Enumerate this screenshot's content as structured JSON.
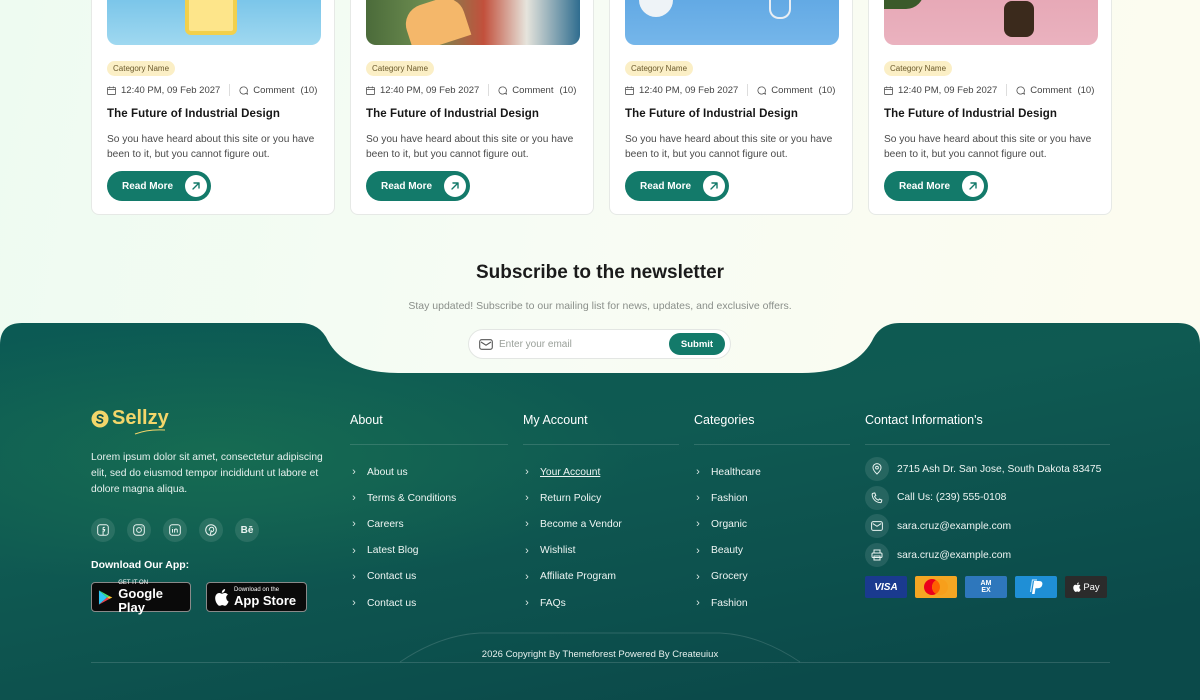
{
  "blog": {
    "cards": [
      {
        "category": "Category Name",
        "date": "12:40 PM, 09 Feb 2027",
        "comment_label": "Comment",
        "comment_count": "(10)",
        "title": "The Future of Industrial Design",
        "description": "So you have heard about this site or you have been to it, but you cannot figure out.",
        "button": "Read More"
      },
      {
        "category": "Category Name",
        "date": "12:40 PM, 09 Feb 2027",
        "comment_label": "Comment",
        "comment_count": "(10)",
        "title": "The Future of Industrial Design",
        "description": "So you have heard about this site or you have been to it, but you cannot figure out.",
        "button": "Read More"
      },
      {
        "category": "Category Name",
        "date": "12:40 PM, 09 Feb 2027",
        "comment_label": "Comment",
        "comment_count": "(10)",
        "title": "The Future of Industrial Design",
        "description": "So you have heard about this site or you have been to it, but you cannot figure out.",
        "button": "Read More"
      },
      {
        "category": "Category Name",
        "date": "12:40 PM, 09 Feb 2027",
        "comment_label": "Comment",
        "comment_count": "(10)",
        "title": "The Future of Industrial Design",
        "description": "So you have heard about this site or you have been to it, but you cannot figure out.",
        "button": "Read More"
      }
    ]
  },
  "newsletter": {
    "title": "Subscribe to the newsletter",
    "subtitle": "Stay updated! Subscribe to our mailing list for news, updates, and exclusive offers.",
    "placeholder": "Enter your email",
    "submit": "Submit"
  },
  "footer": {
    "brand": "Sellzy",
    "about_text": "Lorem ipsum dolor sit amet, consectetur adipiscing elit, sed do eiusmod tempor incididunt ut labore et dolore magna aliqua.",
    "socials": [
      "facebook-icon",
      "instagram-icon",
      "linkedin-icon",
      "pinterest-icon",
      "behance-icon"
    ],
    "download_label": "Download Our App:",
    "google_play": {
      "small": "GET IT ON",
      "big": "Google Play"
    },
    "app_store": {
      "small": "Download on the",
      "big": "App Store"
    },
    "about": {
      "title": "About",
      "links": [
        "About us",
        "Terms & Conditions",
        "Careers",
        "Latest Blog",
        "Contact us",
        "Contact us"
      ]
    },
    "account": {
      "title": "My Account",
      "links": [
        "Your Account",
        "Return Policy",
        "Become a Vendor",
        "Wishlist",
        "Affiliate Program",
        "FAQs"
      ]
    },
    "categories": {
      "title": "Categories",
      "links": [
        "Healthcare",
        "Fashion",
        "Organic",
        "Beauty",
        "Grocery",
        "Fashion"
      ]
    },
    "contact": {
      "title": "Contact Information's",
      "address": "2715 Ash Dr. San Jose, South Dakota 83475",
      "phone": "Call Us: (239) 555-0108",
      "email": "sara.cruz@example.com",
      "fax": "sara.cruz@example.com"
    },
    "payments": {
      "visa": "VISA",
      "amex_line1": "AM",
      "amex_line2": "EX",
      "apple": "Pay"
    },
    "copyright": "2026 Copyright By Themeforest Powered By Createuiux",
    "colors": {
      "primary": "#137a6a",
      "footer_bg": "#0d4f4b",
      "accent": "#f3d66a"
    }
  }
}
